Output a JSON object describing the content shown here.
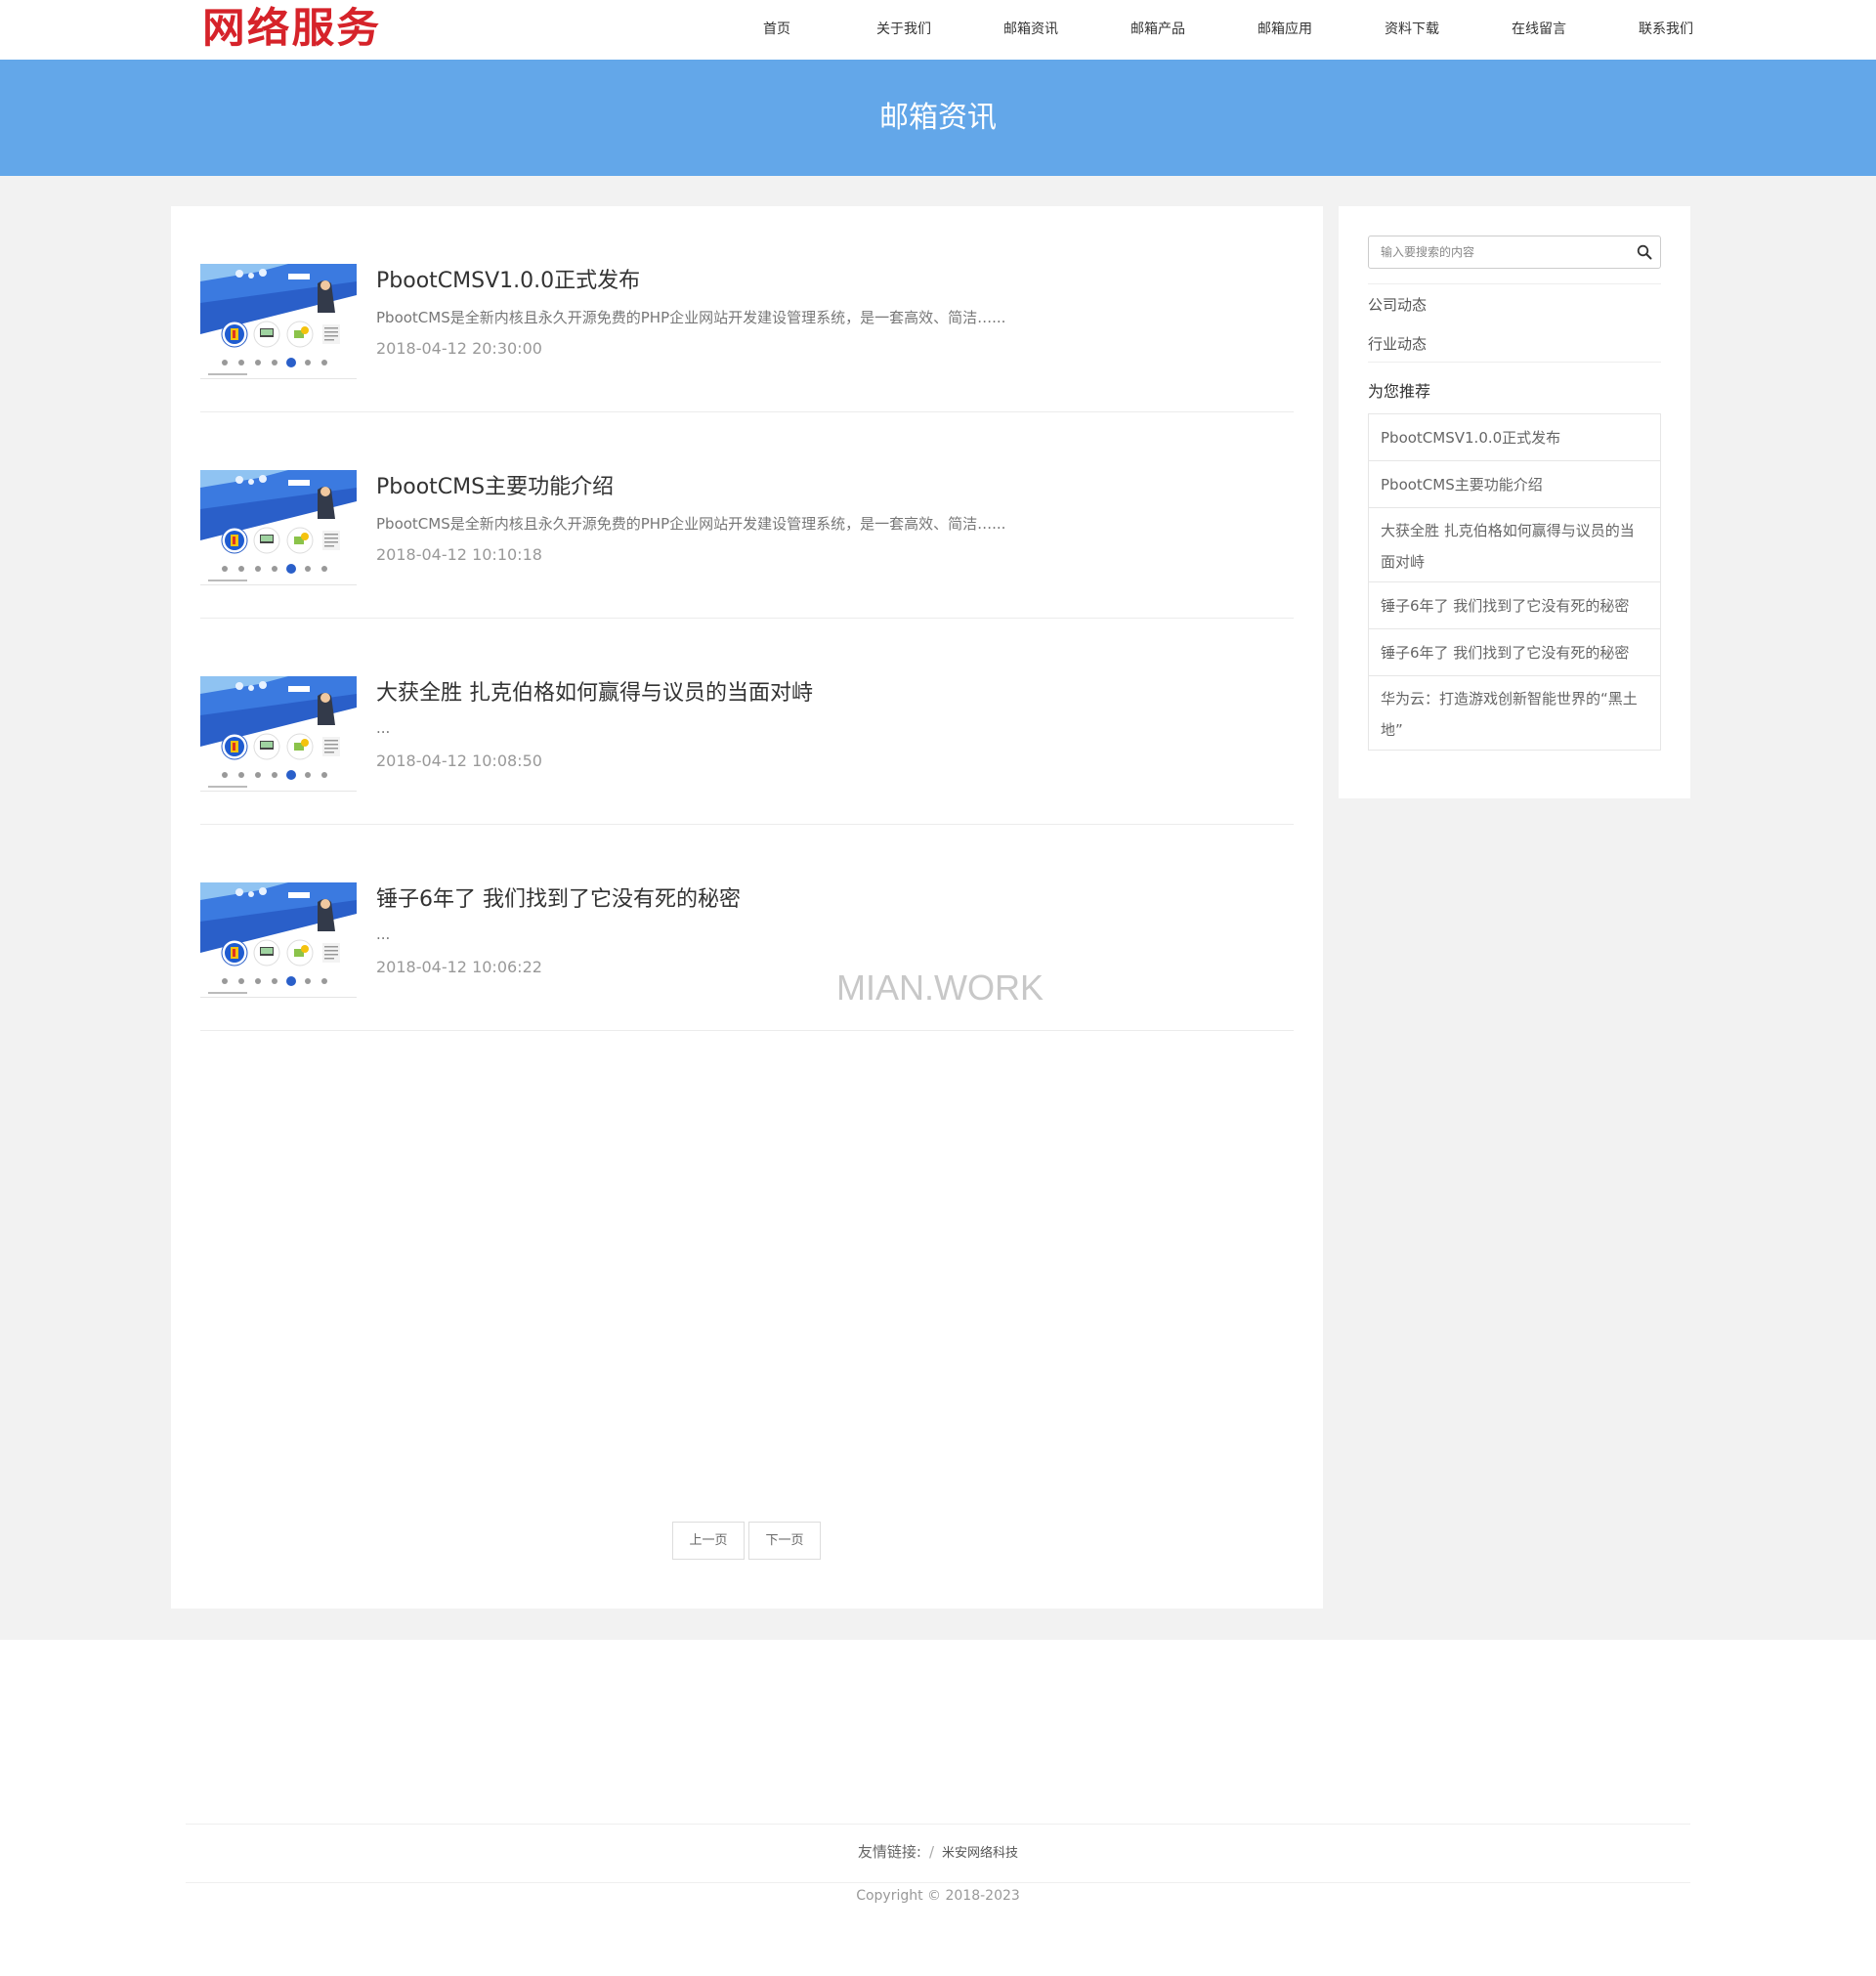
{
  "header": {
    "logo_text": "网络服务",
    "nav": [
      "首页",
      "关于我们",
      "邮箱资讯",
      "邮箱产品",
      "邮箱应用",
      "资料下载",
      "在线留言",
      "联系我们"
    ]
  },
  "banner": {
    "title": "邮箱资讯"
  },
  "news": [
    {
      "title": "PbootCMSV1.0.0正式发布",
      "desc": "PbootCMS是全新内核且永久开源免费的PHP企业网站开发建设管理系统，是一套高效、简洁…...",
      "date": "2018-04-12 20:30:00"
    },
    {
      "title": "PbootCMS主要功能介绍",
      "desc": "PbootCMS是全新内核且永久开源免费的PHP企业网站开发建设管理系统，是一套高效、简洁…...",
      "date": "2018-04-12 10:10:18"
    },
    {
      "title": "大获全胜 扎克伯格如何赢得与议员的当面对峙",
      "desc": "...",
      "date": "2018-04-12 10:08:50"
    },
    {
      "title": "锤子6年了 我们找到了它没有死的秘密",
      "desc": "...",
      "date": "2018-04-12 10:06:22"
    }
  ],
  "pager": {
    "prev": "上一页",
    "next": "下一页"
  },
  "sidebar": {
    "search_placeholder": "输入要搜索的内容",
    "categories": [
      "公司动态",
      "行业动态"
    ],
    "recommend_title": "为您推荐",
    "recommend": [
      "PbootCMSV1.0.0正式发布",
      "PbootCMS主要功能介绍",
      "大获全胜 扎克伯格如何赢得与议员的当面对峙",
      "锤子6年了 我们找到了它没有死的秘密",
      "锤子6年了 我们找到了它没有死的秘密",
      "华为云：打造游戏创新智能世界的“黑土地”"
    ]
  },
  "watermark": "MIAN.WORK",
  "footer": {
    "links_label": "友情链接:",
    "separator": "/",
    "link": "米安网络科技",
    "copyright": "Copyright © 2018-2023"
  },
  "colors": {
    "banner": "#63a7e9",
    "logo": "#d6232a"
  }
}
